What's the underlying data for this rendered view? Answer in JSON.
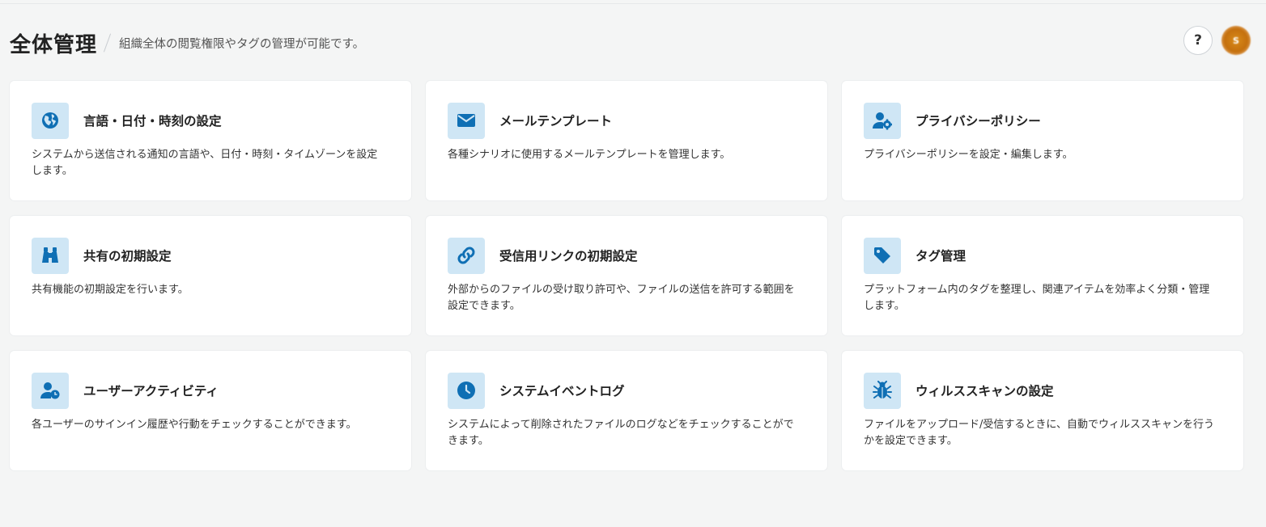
{
  "header": {
    "title": "全体管理",
    "subtitle": "組織全体の閲覧権限やタグの管理が可能です。",
    "help_label": "?",
    "avatar_initial": "S"
  },
  "theme": {
    "accent": "#0f6fb4",
    "icon_bg": "#cfe6f5",
    "page_bg": "#f4f5f5"
  },
  "cards": [
    {
      "icon": "globe-icon",
      "title": "言語・日付・時刻の設定",
      "description": "システムから送信される通知の言語や、日付・時刻・タイムゾーンを設定します。"
    },
    {
      "icon": "envelope-icon",
      "title": "メールテンプレート",
      "description": "各種シナリオに使用するメールテンプレートを管理します。"
    },
    {
      "icon": "user-gear-icon",
      "title": "プライバシーポリシー",
      "description": "プライバシーポリシーを設定・編集します。"
    },
    {
      "icon": "binoculars-icon",
      "title": "共有の初期設定",
      "description": "共有機能の初期設定を行います。"
    },
    {
      "icon": "link-icon",
      "title": "受信用リンクの初期設定",
      "description": "外部からのファイルの受け取り許可や、ファイルの送信を許可する範囲を設定できます。"
    },
    {
      "icon": "tag-icon",
      "title": "タグ管理",
      "description": "プラットフォーム内のタグを整理し、関連アイテムを効率よく分類・管理します。"
    },
    {
      "icon": "user-clock-icon",
      "title": "ユーザーアクティビティ",
      "description": "各ユーザーのサインイン履歴や行動をチェックすることができます。"
    },
    {
      "icon": "clock-icon",
      "title": "システムイベントログ",
      "description": "システムによって削除されたファイルのログなどをチェックすることができます。"
    },
    {
      "icon": "bug-icon",
      "title": "ウィルススキャンの設定",
      "description": "ファイルをアップロード/受信するときに、自動でウィルススキャンを行うかを設定できます。"
    }
  ]
}
